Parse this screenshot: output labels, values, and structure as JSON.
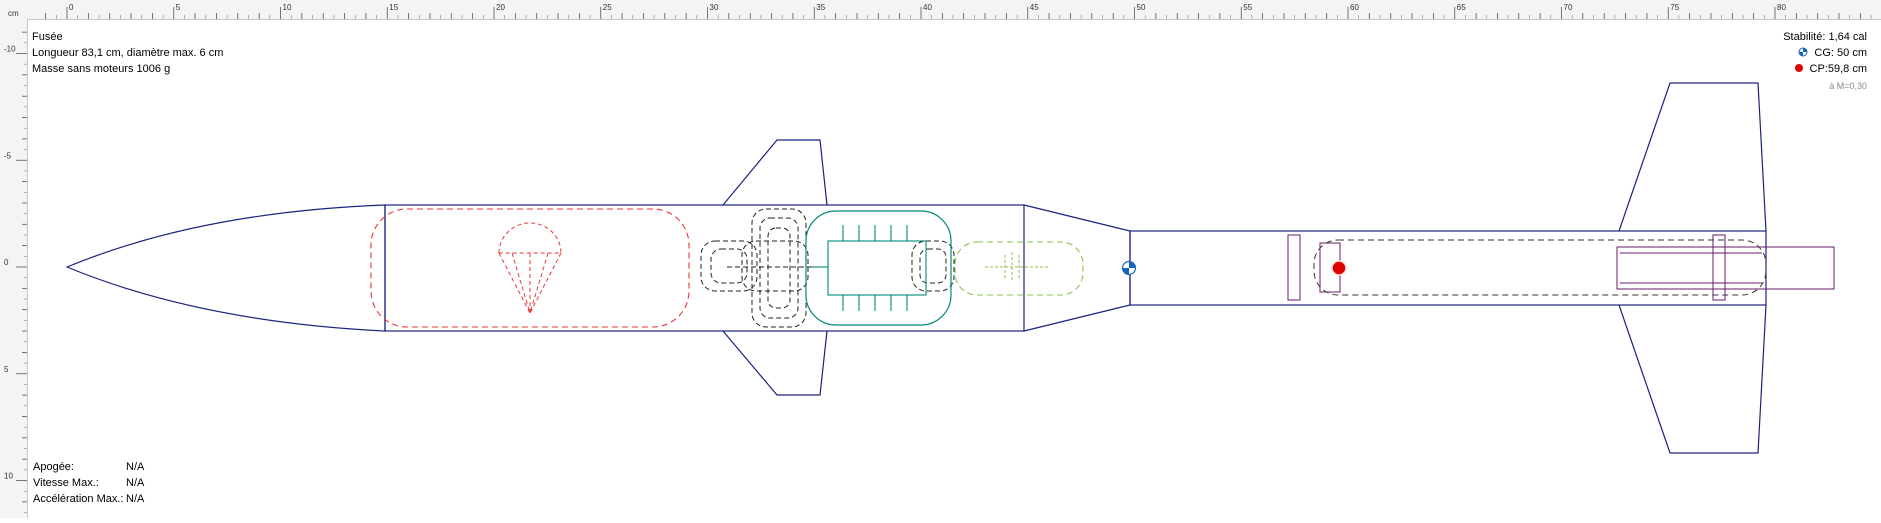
{
  "ruler": {
    "unit": "cm",
    "horizontal_labels": [
      "0",
      "5",
      "10",
      "15",
      "20",
      "25",
      "30",
      "35",
      "40",
      "45",
      "50",
      "55",
      "60",
      "65",
      "70",
      "75",
      "80"
    ],
    "vertical_labels": [
      "-10",
      "-5",
      "0",
      "5",
      "10"
    ]
  },
  "info": {
    "name": "Fusée",
    "dimensions": "Longueur 83,1 cm, diamètre max. 6 cm",
    "mass": "Masse sans moteurs 1006 g"
  },
  "stability": {
    "label": "Stabilité: 1,64 cal",
    "cg": "CG:   50 cm",
    "cp": "CP:59,8 cm",
    "mach": "à M=0,30"
  },
  "flight": {
    "apogee_label": "Apogée:",
    "apogee_value": "N/A",
    "velocity_label": "Vitesse Max.:",
    "velocity_value": "N/A",
    "accel_label": "Accélération Max.:",
    "accel_value": "N/A"
  },
  "colors": {
    "body": "#1a237e",
    "recovery": "#e53935",
    "shock_cord": "#222222",
    "electronics": "#00897b",
    "mass_component": "#8bc34a",
    "motor": "#6a1b6a",
    "cg_marker": "#1565c0",
    "cp_marker": "#e00000"
  }
}
